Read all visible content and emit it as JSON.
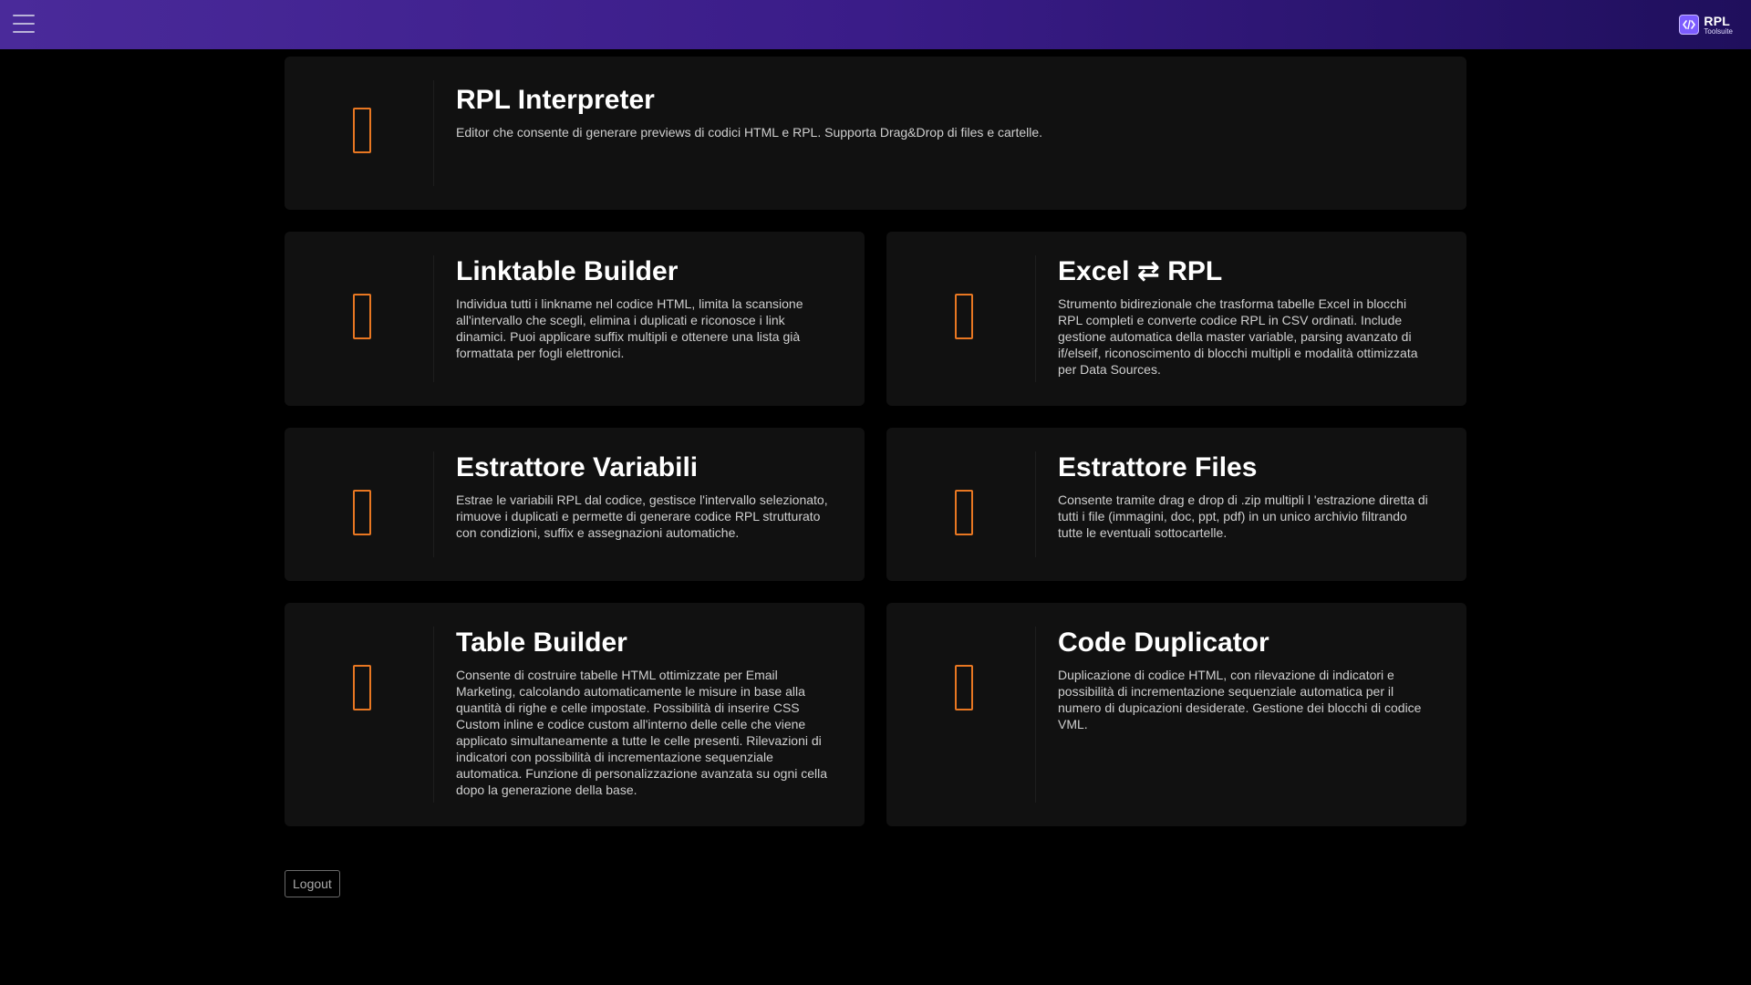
{
  "header": {
    "menu_icon": "hamburger-menu-icon",
    "logo": {
      "icon": "code-brackets-icon",
      "title": "RPL",
      "subtitle": "Toolsuite",
      "accent": "#7c5cff"
    },
    "gradient": [
      "#4a2a9a",
      "#1f0f5c"
    ]
  },
  "accent_icon_color": "#e87722",
  "tools": [
    {
      "icon": "missing-glyph-icon",
      "title": "RPL Interpreter",
      "description": "Editor che consente di generare previews di codici HTML e RPL. Supporta Drag&Drop di files e cartelle."
    },
    {
      "icon": "missing-glyph-icon",
      "title": "Linktable Builder",
      "description": "Individua tutti i linkname nel codice HTML, limita la scansione all'intervallo che scegli, elimina i duplicati e riconosce i link dinamici. Puoi applicare suffix multipli e ottenere una lista già formattata per fogli elettronici."
    },
    {
      "icon": "missing-glyph-icon",
      "title": "Excel ⇄ RPL",
      "description": "Strumento bidirezionale che trasforma tabelle Excel in blocchi RPL completi e converte codice RPL in CSV ordinati. Include gestione automatica della master variable, parsing avanzato di if/elseif, riconoscimento di blocchi multipli e modalità ottimizzata per Data Sources."
    },
    {
      "icon": "missing-glyph-icon",
      "title": "Estrattore Variabili",
      "description": "Estrae le variabili RPL dal codice, gestisce l'intervallo selezionato, rimuove i duplicati e permette di generare codice RPL strutturato con condizioni, suffix e assegnazioni automatiche."
    },
    {
      "icon": "missing-glyph-icon",
      "title": "Estrattore Files",
      "description": "Consente tramite drag e drop di .zip multipli l 'estrazione diretta di tutti i file (immagini, doc, ppt, pdf) in un unico archivio filtrando tutte le eventuali sottocartelle."
    },
    {
      "icon": "missing-glyph-icon",
      "title": "Table Builder",
      "description": "Consente di costruire tabelle HTML ottimizzate per Email Marketing, calcolando automaticamente le misure in base alla quantità di righe e celle impostate. Possibilità di inserire CSS Custom inline e codice custom all'interno delle celle che viene applicato simultaneamente a tutte le celle presenti. Rilevazioni di indicatori con possibilità di incrementazione sequenziale automatica. Funzione di personalizzazione avanzata su ogni cella dopo la generazione della base."
    },
    {
      "icon": "missing-glyph-icon",
      "title": "Code Duplicator",
      "description": "Duplicazione di codice HTML, con rilevazione di indicatori e possibilità di incrementazione sequenziale automatica per il numero di dupicazioni desiderate. Gestione dei blocchi di codice VML."
    }
  ],
  "logout_label": "Logout"
}
